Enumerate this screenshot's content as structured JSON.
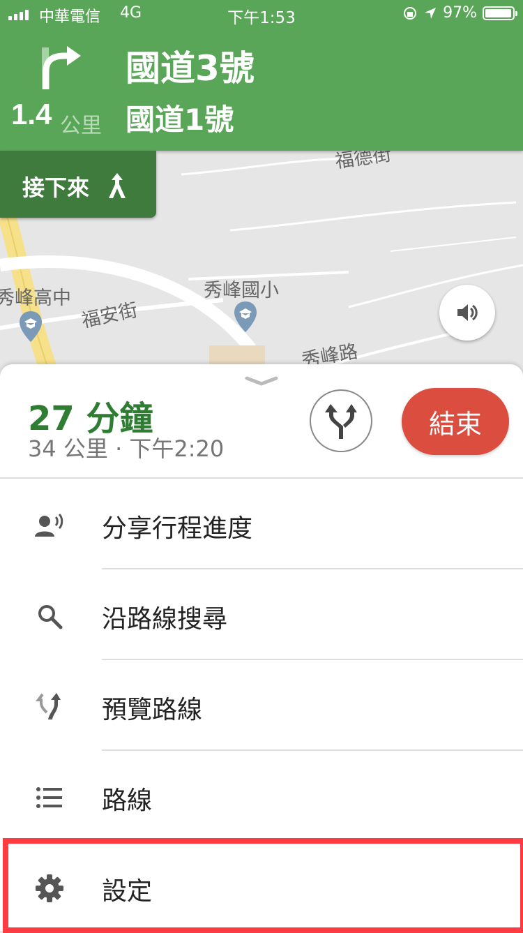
{
  "status_bar": {
    "carrier": "中華電信",
    "network": "4G",
    "time": "下午1:53",
    "battery": "97%",
    "battery_level": 0.97
  },
  "navigation": {
    "distance": "1.4",
    "distance_unit": "公里",
    "primary_road": "國道3號",
    "secondary_road": "國道1號",
    "turn_icon": "turn-right-icon"
  },
  "then_chip": {
    "label": "接下來",
    "icon": "fork-icon"
  },
  "map": {
    "labels": {
      "school_1": "秀峰國小",
      "school_2": "秀峰高中",
      "street_1": "福安街",
      "street_2": "秀峰路",
      "street_top": "福德街"
    }
  },
  "eta": {
    "duration": "27 分鐘",
    "details": "34 公里 · 下午2:20"
  },
  "end_button": {
    "label": "結束"
  },
  "menu": {
    "items": [
      {
        "label": "分享行程進度",
        "icon": "share-location-icon"
      },
      {
        "label": "沿路線搜尋",
        "icon": "search-icon"
      },
      {
        "label": "預覽路線",
        "icon": "route-preview-icon"
      },
      {
        "label": "路線",
        "icon": "list-icon"
      },
      {
        "label": "設定",
        "icon": "gear-icon"
      }
    ]
  },
  "colors": {
    "nav_green": "#5aa658",
    "then_green": "#3e7b3c",
    "eta_green": "#2e7d32",
    "end_red": "#db4d3f",
    "highlight_red": "#ff3b42"
  }
}
